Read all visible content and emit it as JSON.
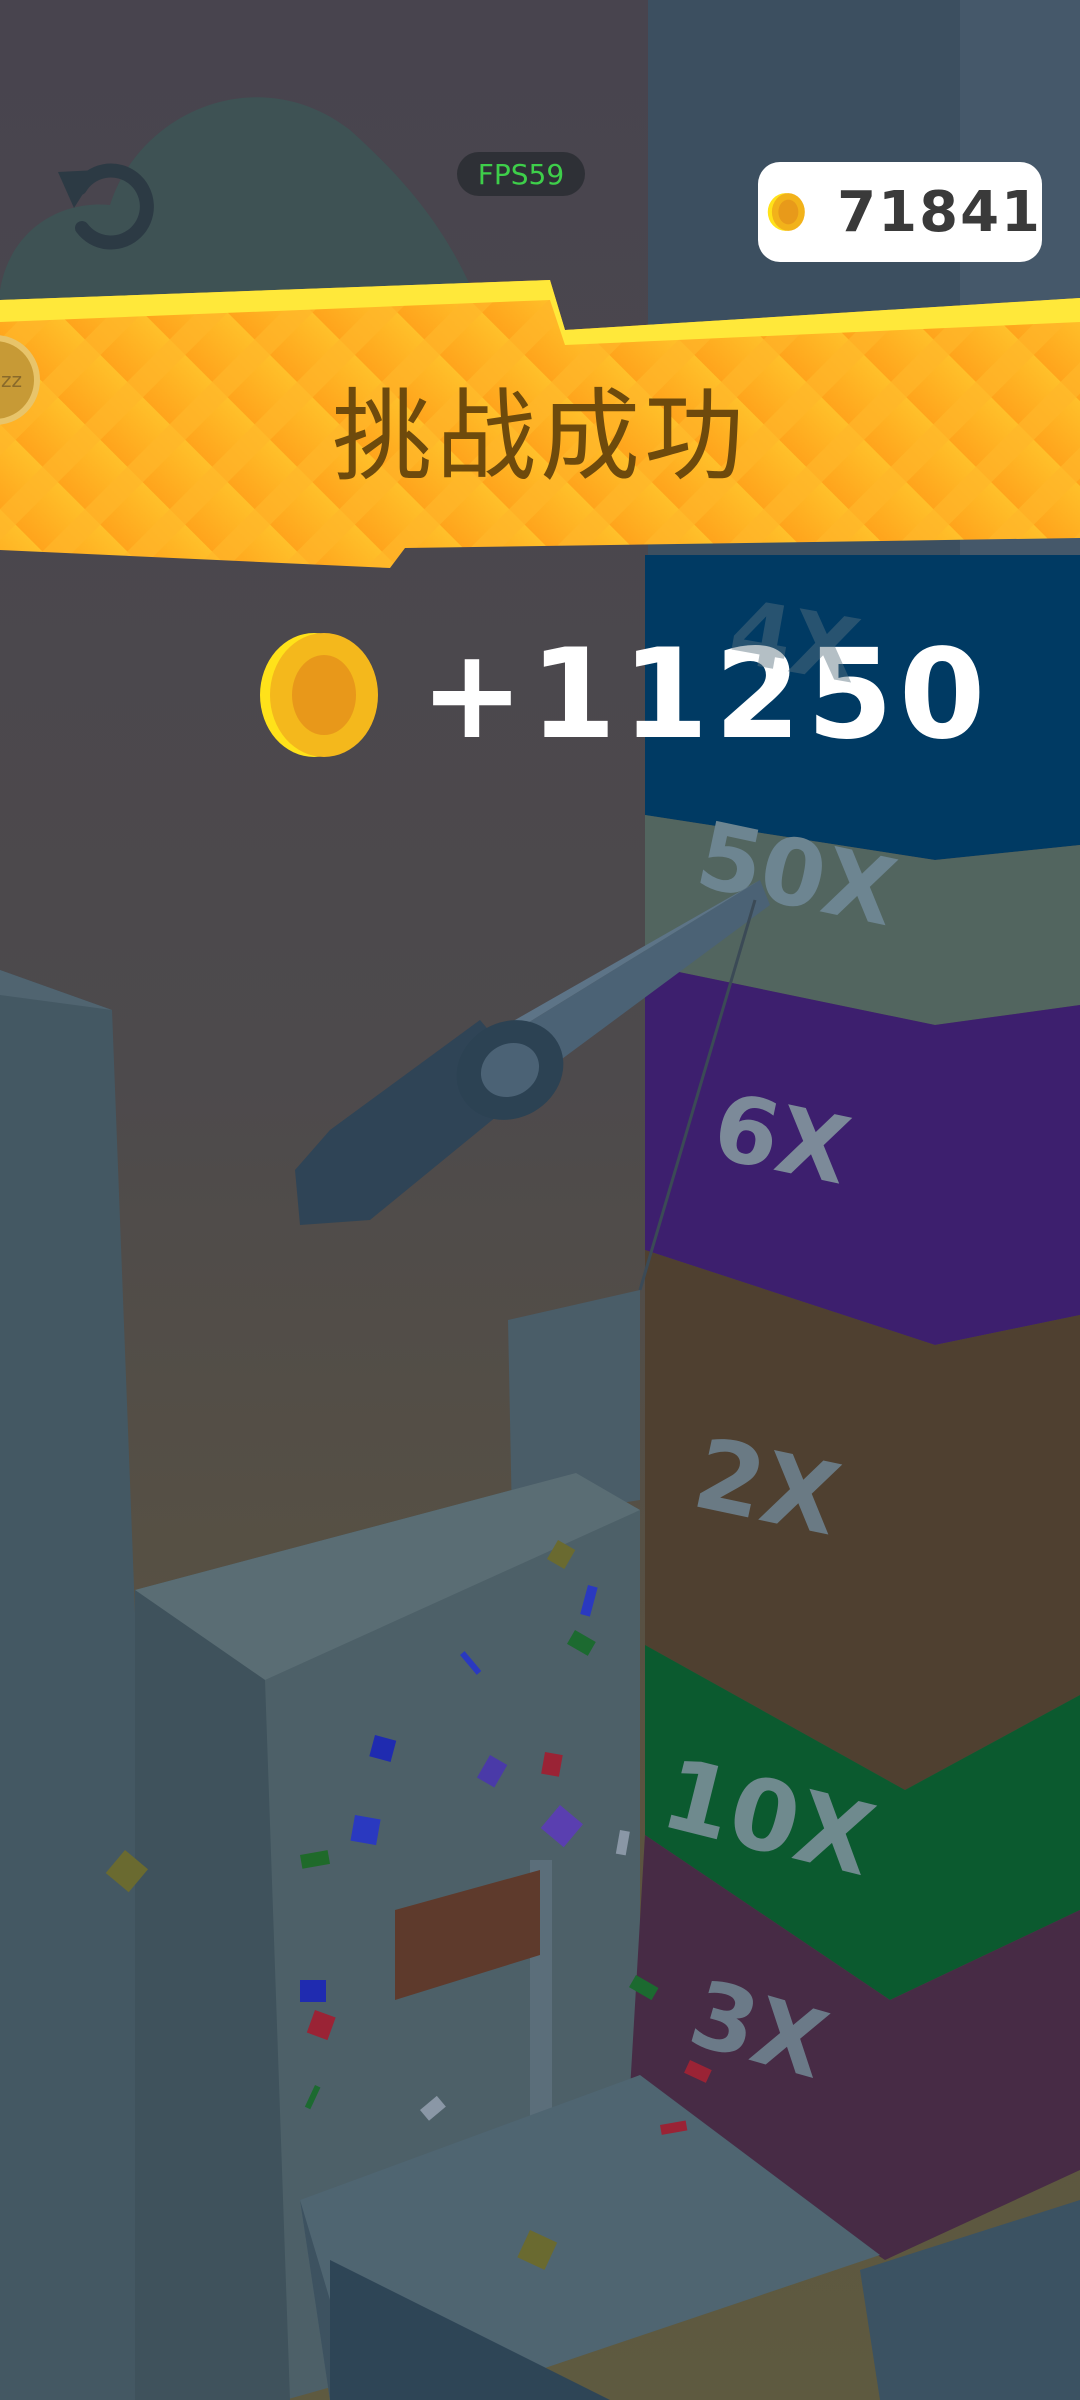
{
  "hud": {
    "fps": "FPS59",
    "coins": "71841"
  },
  "result": {
    "title": "挑战成功",
    "reward": "+11250"
  },
  "side_token": {
    "label": "zz"
  },
  "tower_blocks": [
    {
      "label": "4X",
      "color": "#003a63"
    },
    {
      "label": "50X",
      "color": "#52655f"
    },
    {
      "label": "6X",
      "color": "#3d1f6e"
    },
    {
      "label": "2X",
      "color": "#4f4030"
    },
    {
      "label": "10X",
      "color": "#0b5a2f"
    },
    {
      "label": "3X",
      "color": "#472b45"
    }
  ],
  "colors": {
    "banner": "#ffae1e",
    "coin": "#f7c21a",
    "fps_text": "#3ecf4a"
  }
}
